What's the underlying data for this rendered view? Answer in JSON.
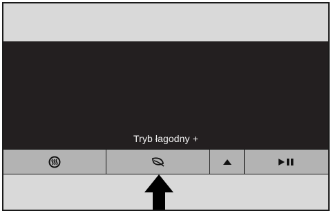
{
  "display": {
    "mode_label": "Tryb łagodny +"
  },
  "buttons": [
    {
      "icon": "steam-icon"
    },
    {
      "icon": "leaf-icon"
    },
    {
      "icon": "triangle-up-icon"
    },
    {
      "icon": "play-pause-icon"
    }
  ],
  "colors": {
    "screen": "#231f20",
    "panel": "#d9d9d9",
    "button_bar": "#b3b3b3",
    "outline": "#1a1a1a"
  }
}
